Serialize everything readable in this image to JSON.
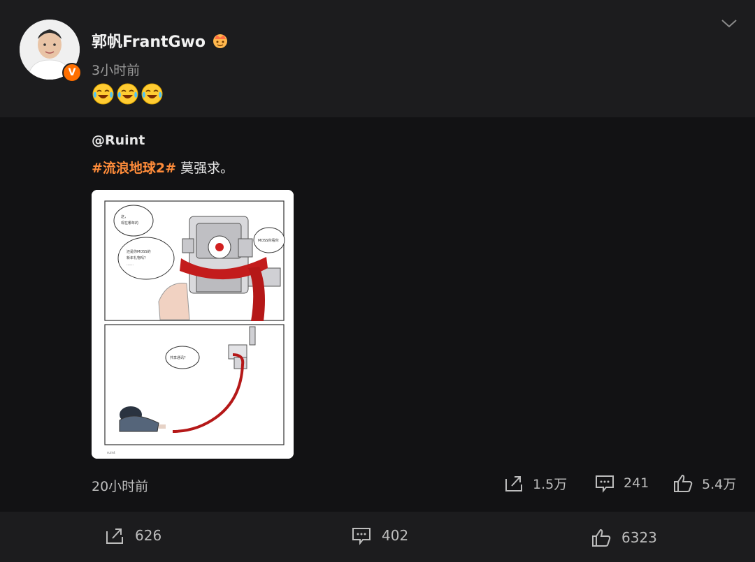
{
  "post": {
    "username": "郭帆FrantGwo",
    "time": "3小时前",
    "emoji": [
      "laugh-cry-emoji",
      "laugh-cry-emoji",
      "laugh-cry-emoji"
    ],
    "verified_badge": "V"
  },
  "repost": {
    "author": "@Ruint",
    "hashtag": "#流浪地球2#",
    "text": " 莫强求。",
    "time": "20小时前",
    "stats": {
      "share": "1.5万",
      "comment": "241",
      "like": "5.4万"
    },
    "comic": {
      "bubble1": "这，\n现在哪年的",
      "bubble2": "还是你MOSS的\n…（字迹模糊）",
      "bubble3": "MOSS你看你",
      "bubble4": "共享通讯？"
    }
  },
  "actions": {
    "share": "626",
    "comment": "402",
    "like": "6323"
  },
  "colors": {
    "background": "#1c1c1e",
    "card": "#121214",
    "hashtag": "#ff8c3a",
    "badge": "#ff6f00"
  }
}
